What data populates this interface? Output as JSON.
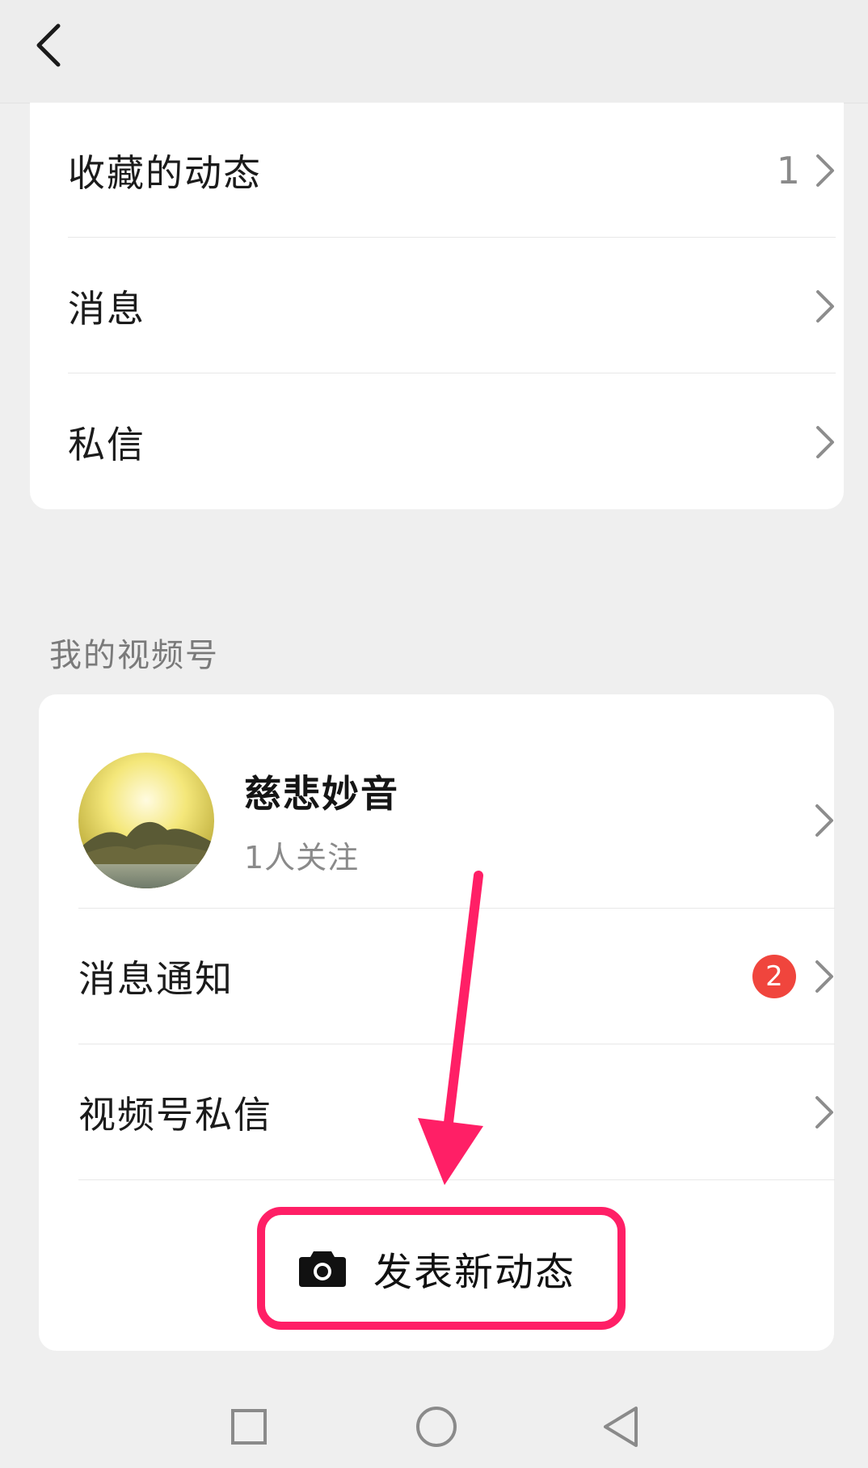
{
  "header": {
    "back_icon": "chevron-left-icon"
  },
  "top_card": {
    "items": [
      {
        "label": "收藏的动态",
        "count": "1"
      },
      {
        "label": "消息"
      },
      {
        "label": "私信"
      }
    ]
  },
  "channels_section": {
    "title": "我的视频号",
    "profile": {
      "name": "慈悲妙音",
      "followers": "1人关注",
      "avatar": "landscape-avatar"
    },
    "items": [
      {
        "label": "消息通知",
        "badge": "2"
      },
      {
        "label": "视频号私信"
      }
    ],
    "post_button": {
      "label": "发表新动态",
      "icon": "camera-icon"
    }
  },
  "colors": {
    "background": "#efefef",
    "card": "#ffffff",
    "badge": "#f0453d",
    "highlight": "#ff1f66"
  },
  "navbar": {
    "icons": [
      "square-icon",
      "circle-icon",
      "triangle-back-icon"
    ]
  }
}
